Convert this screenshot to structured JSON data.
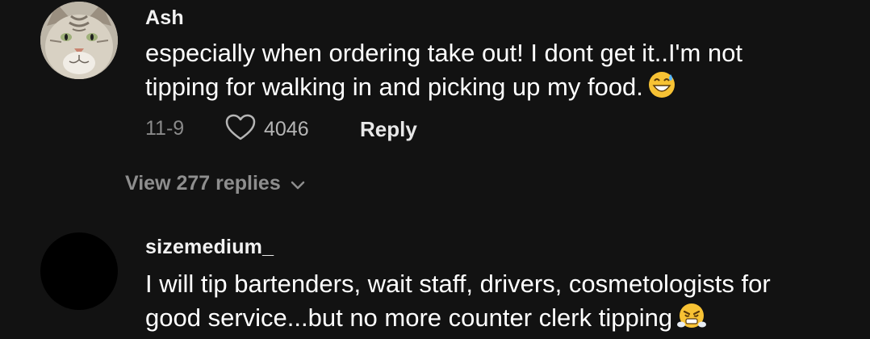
{
  "comments": [
    {
      "username": "Ash",
      "line1": "especially when ordering take out! I dont get it..I'm not",
      "line2": "tipping for walking in and picking up my food.",
      "emoji": "grinning-sweat",
      "date": "11-9",
      "likes": "4046",
      "reply_label": "Reply",
      "view_replies": "View 277 replies"
    },
    {
      "username": "sizemedium_",
      "line1": "I will tip bartenders, wait staff, drivers, cosmetologists for",
      "line2": "good service...but no more counter clerk tipping",
      "emoji": "face-with-steam"
    }
  ],
  "colors": {
    "background": "#121212",
    "text": "#ffffff",
    "muted": "#8a8a8a"
  }
}
